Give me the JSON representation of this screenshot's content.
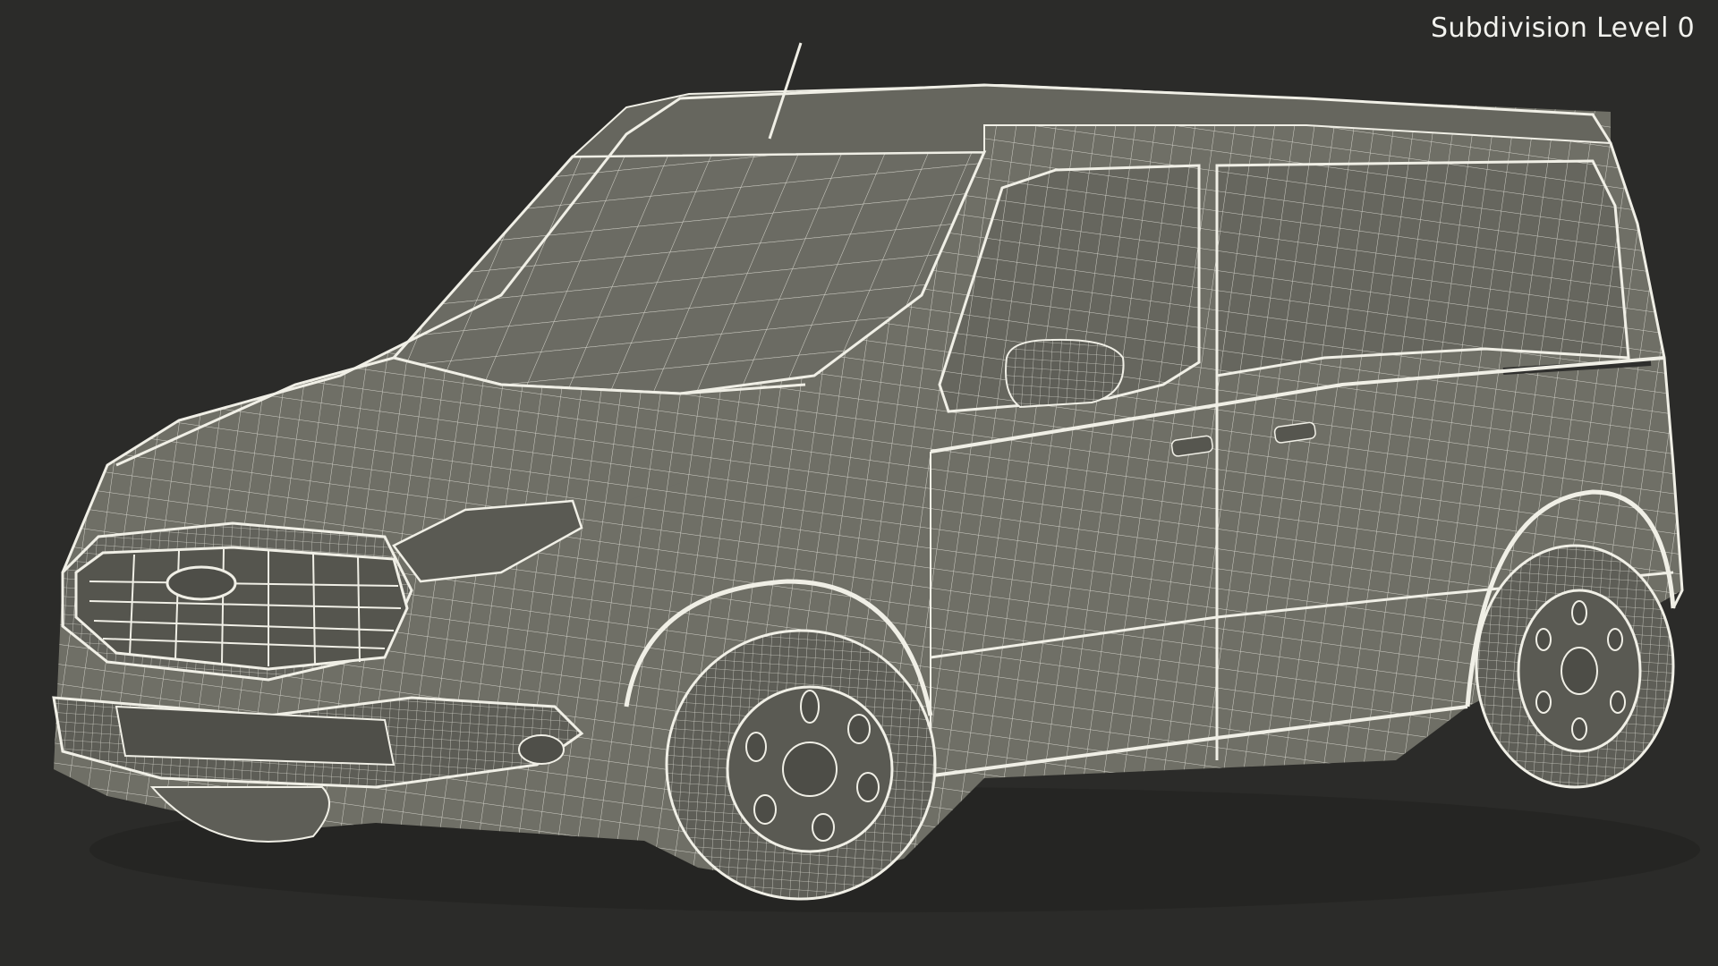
{
  "viewport": {
    "overlay_label": "Subdivision Level 0"
  },
  "model": {
    "subject": "wireframe-van-render",
    "colors": {
      "background": "#2b2b29",
      "body": "#6f6f66",
      "body_shadow": "#54544d",
      "glass": "#66665e",
      "wire": "#f0efe6",
      "tire": "#5e5e57"
    }
  }
}
